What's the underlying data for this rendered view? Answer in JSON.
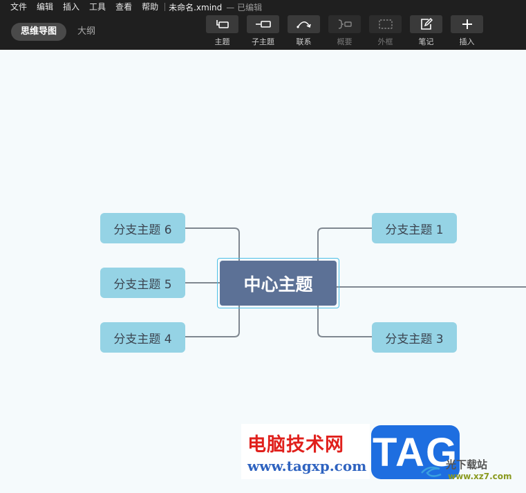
{
  "menubar": {
    "items": [
      "文件",
      "编辑",
      "插入",
      "工具",
      "查看",
      "帮助"
    ],
    "doc_title": "未命名.xmind",
    "doc_status": "— 已编辑"
  },
  "view_tabs": {
    "mindmap": "思维导图",
    "outline": "大纲"
  },
  "toolbar": {
    "topic": "主题",
    "subtopic": "子主题",
    "relationship": "联系",
    "summary": "概要",
    "boundary": "外框",
    "note": "笔记",
    "insert": "插入"
  },
  "mindmap": {
    "central": "中心主题",
    "branches": [
      "分支主题 1",
      "分支主题 3",
      "分支主题 4",
      "分支主题 5",
      "分支主题 6"
    ]
  },
  "watermark": {
    "title": "电脑技术网",
    "url": "www.tagxp.com",
    "tag": "TAG",
    "site_name": "光下载站",
    "site_url": "www.xz7.com"
  },
  "colors": {
    "topbar": "#1f1f1f",
    "canvas": "#f5fafc",
    "central_topic": "#5c7196",
    "branch_topic": "#95d3e5",
    "connector": "#7f8790",
    "selection": "#4bbfe6"
  }
}
